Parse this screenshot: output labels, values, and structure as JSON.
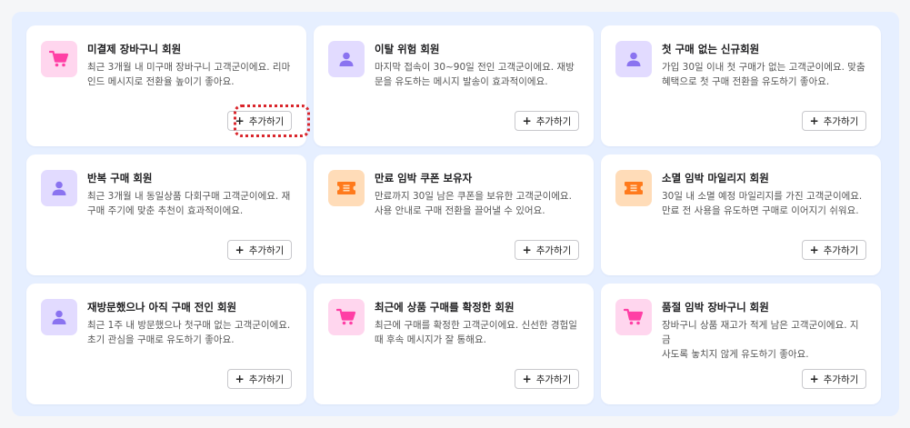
{
  "colors": {
    "panel_bg": "#e6efff",
    "icon_pink_bg": "#ffd6ee",
    "icon_pink": "#ff3fa5",
    "icon_purple_bg": "#e2dbff",
    "icon_purple": "#8a73f0",
    "icon_orange_bg": "#ffdcb8",
    "icon_orange": "#ff7a1c",
    "focus_ring": "#d9252b"
  },
  "add_button_label": "추가하기",
  "add_button_icon": "plus-icon",
  "focused_card_index": 0,
  "cards": [
    {
      "icon": "cart-icon",
      "color": "pink",
      "title": "미결제 장바구니 회원",
      "desc_lines": [
        "최근 3개월 내 미구매 장바구니 고객군이에요. 리마",
        "인드 메시지로 전환율 높이기 좋아요."
      ],
      "button_label": "추가하기"
    },
    {
      "icon": "user-icon",
      "color": "purple",
      "title": "이탈 위험 회원",
      "desc_lines": [
        "마지막 접속이 30~90일 전인 고객군이에요. 재방",
        "문을 유도하는 메시지 발송이 효과적이에요."
      ],
      "button_label": "추가하기"
    },
    {
      "icon": "user-icon",
      "color": "purple",
      "title": "첫 구매 없는 신규회원",
      "desc_lines": [
        "가입 30일 이내 첫 구매가 없는 고객군이에요. 맞춤",
        "혜택으로 첫 구매 전환을 유도하기 좋아요."
      ],
      "button_label": "추가하기"
    },
    {
      "icon": "user-icon",
      "color": "purple",
      "title": "반복 구매 회원",
      "desc_lines": [
        "최근 3개월 내 동일상품 다회구매 고객군이에요. 재",
        "구매 주기에 맞춘 추천이 효과적이에요."
      ],
      "button_label": "추가하기"
    },
    {
      "icon": "ticket-icon",
      "color": "orange",
      "title": "만료 임박 쿠폰 보유자",
      "desc_lines": [
        "만료까지 30일 남은 쿠폰을 보유한 고객군이에요.",
        "사용 안내로 구매 전환을 끌어낼 수 있어요."
      ],
      "button_label": "추가하기"
    },
    {
      "icon": "ticket-icon",
      "color": "orange",
      "title": "소멸 임박 마일리지 회원",
      "desc_lines": [
        "30일 내 소멸 예정 마일리지를 가진 고객군이에요.",
        "만료 전 사용을 유도하면 구매로 이어지기 쉬워요."
      ],
      "button_label": "추가하기"
    },
    {
      "icon": "user-icon",
      "color": "purple",
      "title": "재방문했으나 아직 구매 전인 회원",
      "desc_lines": [
        "최근 1주 내 방문했으나 첫구매 없는 고객군이에요.",
        "초기 관심을 구매로 유도하기 좋아요."
      ],
      "button_label": "추가하기"
    },
    {
      "icon": "cart-icon",
      "color": "pink",
      "title": "최근에 상품 구매를 확정한 회원",
      "desc_lines": [
        "최근에 구매를 확정한 고객군이에요. 신선한 경험일",
        "때 후속 메시지가 잘 통해요."
      ],
      "button_label": "추가하기"
    },
    {
      "icon": "cart-icon",
      "color": "pink",
      "title": "품절 임박 장바구니 회원",
      "desc_lines": [
        "장바구니 상품 재고가 적게 남은 고객군이에요. 지금",
        "사도록 놓치지 않게 유도하기 좋아요."
      ],
      "button_label": "추가하기"
    }
  ]
}
